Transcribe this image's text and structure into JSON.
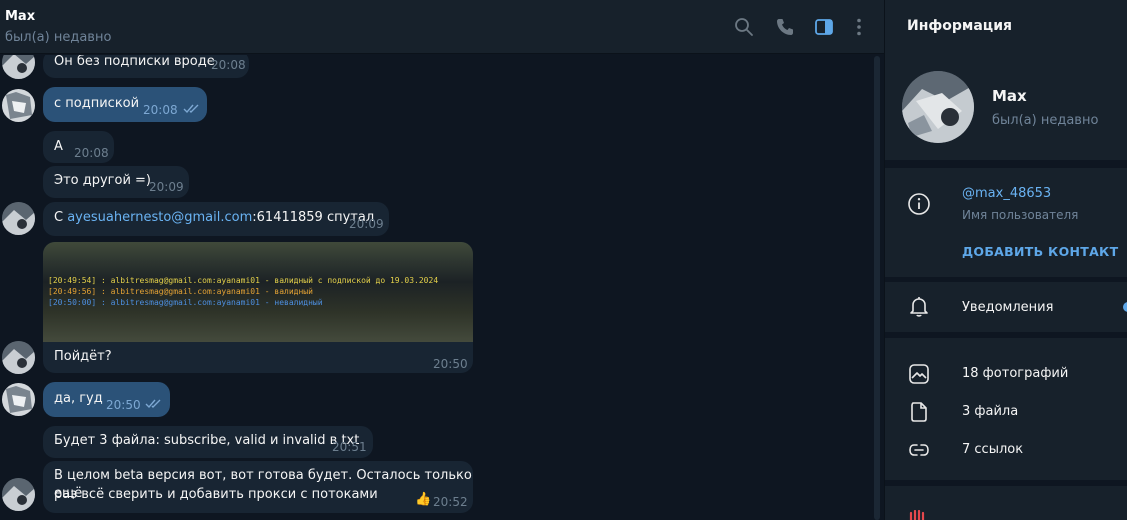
{
  "header": {
    "title": "Max",
    "status": "был(а) недавно"
  },
  "messages": [
    {
      "text": "Он без подписки вроде",
      "time": "20:08",
      "direction": "in"
    },
    {
      "text": "с подпиской",
      "time": "20:08",
      "direction": "out"
    },
    {
      "text": "А",
      "time": "20:08",
      "direction": "in"
    },
    {
      "text": "Это другой =)",
      "time": "20:09",
      "direction": "in"
    },
    {
      "text_prefix": "С ",
      "link": "ayesuahernesto@gmail.com",
      "text_suffix": ":61411859 спутал",
      "time": "20:09",
      "direction": "in"
    },
    {
      "image_lines": [
        "[20:49:54] : albitresmag@gmail.com:ayanami01 - валидный с подпиской до 19.03.2024",
        "[20:49:56] : albitresmag@gmail.com:ayanami01 - валидный",
        "[20:50:00] : albitresmag@gmail.com:ayanami01 - невалидный"
      ],
      "image_line_colors": [
        "#e3d04a",
        "#e3a234",
        "#4d8fe0"
      ],
      "text": "Пойдёт?",
      "time": "20:50",
      "direction": "in"
    },
    {
      "text": "да, гуд",
      "time": "20:50",
      "direction": "out"
    },
    {
      "text": "Будет 3 файла: subscribe, valid и invalid в txt",
      "time": "20:51",
      "direction": "in"
    },
    {
      "text_line1": "В целом beta версия вот, вот готова будет. Осталось только ещё",
      "text_line2": "раз всё сверить и добавить прокси с потоками",
      "reaction": "👍",
      "time": "20:52",
      "direction": "in"
    }
  ],
  "info": {
    "title": "Информация",
    "name": "Max",
    "status": "был(а) недавно",
    "username": "@max_48653",
    "username_label": "Имя пользователя",
    "add_contact": "ДОБАВИТЬ КОНТАКТ",
    "notifications": "Уведомления",
    "media": [
      {
        "label": "18 фотографий",
        "icon": "photo-icon"
      },
      {
        "label": "3 файла",
        "icon": "file-icon"
      },
      {
        "label": "7 ссылок",
        "icon": "link-icon"
      }
    ]
  },
  "colors": {
    "background": "#0e1621",
    "panel": "#17212b",
    "bubble_in": "#182533",
    "bubble_out": "#2b5278",
    "accent": "#6ab3f3"
  }
}
